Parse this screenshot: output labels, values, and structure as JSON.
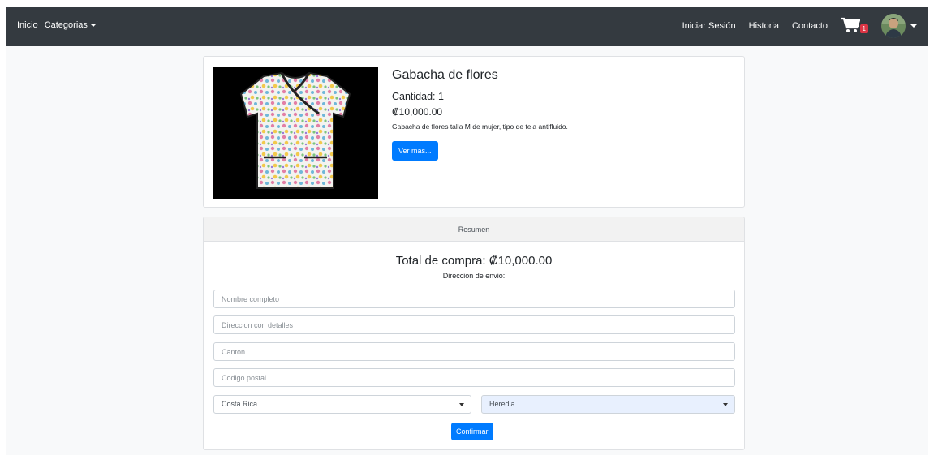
{
  "nav": {
    "home": "Inicio",
    "categories": "Categorias",
    "login": "Iniciar Sesión",
    "history": "Historia",
    "contact": "Contacto",
    "cart_count": "1"
  },
  "product": {
    "title": "Gabacha de flores",
    "quantity": "Cantidad: 1",
    "price": "₡10,000.00",
    "description": "Gabacha de flores talla M de mujer, tipo de tela antifluido.",
    "more_button": "Ver mas..."
  },
  "summary": {
    "header": "Resumen",
    "total": "Total de compra: ₡10,000.00",
    "shipping_label": "Direccion de envio:",
    "name_placeholder": "Nombre completo",
    "address_placeholder": "Direccion con detalles",
    "canton_placeholder": "Canton",
    "postal_placeholder": "Codigo postal",
    "country": "Costa Rica",
    "province": "Heredia",
    "confirm_button": "Confirmar"
  },
  "colors": {
    "navbar": "#343a40",
    "primary": "#007bff",
    "badge": "#dc3545",
    "province_bg": "#e8f0fe"
  }
}
